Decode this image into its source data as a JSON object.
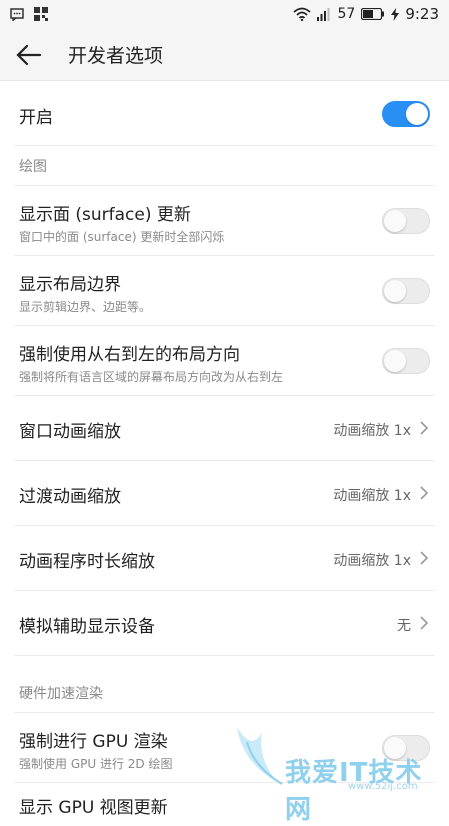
{
  "status_bar": {
    "battery": "57",
    "time": "9:23"
  },
  "app_bar": {
    "title": "开发者选项"
  },
  "master": {
    "label": "开启",
    "on": true
  },
  "sections": {
    "drawing": "绘图",
    "hw": "硬件加速渲染"
  },
  "drawing_items": [
    {
      "title": "显示面 (surface) 更新",
      "subtitle": "窗口中的面 (surface) 更新时全部闪烁",
      "on": false
    },
    {
      "title": "显示布局边界",
      "subtitle": "显示剪辑边界、边距等。",
      "on": false
    },
    {
      "title": "强制使用从右到左的布局方向",
      "subtitle": "强制将所有语言区域的屏幕布局方向改为从右到左",
      "on": false
    }
  ],
  "scale_items": [
    {
      "title": "窗口动画缩放",
      "value": "动画缩放 1x"
    },
    {
      "title": "过渡动画缩放",
      "value": "动画缩放 1x"
    },
    {
      "title": "动画程序时长缩放",
      "value": "动画缩放 1x"
    },
    {
      "title": "模拟辅助显示设备",
      "value": "无"
    }
  ],
  "hw_items": [
    {
      "title": "强制进行 GPU 渲染",
      "subtitle": "强制使用 GPU 进行 2D 绘图",
      "on": false
    },
    {
      "title": "显示 GPU 视图更新"
    }
  ],
  "watermark": {
    "text": "我爱IT技术网",
    "url": "www.52ij.com"
  },
  "colors": {
    "accent": "#2a8ff5",
    "background": "#ffffff",
    "bar": "#f5f5f5"
  }
}
